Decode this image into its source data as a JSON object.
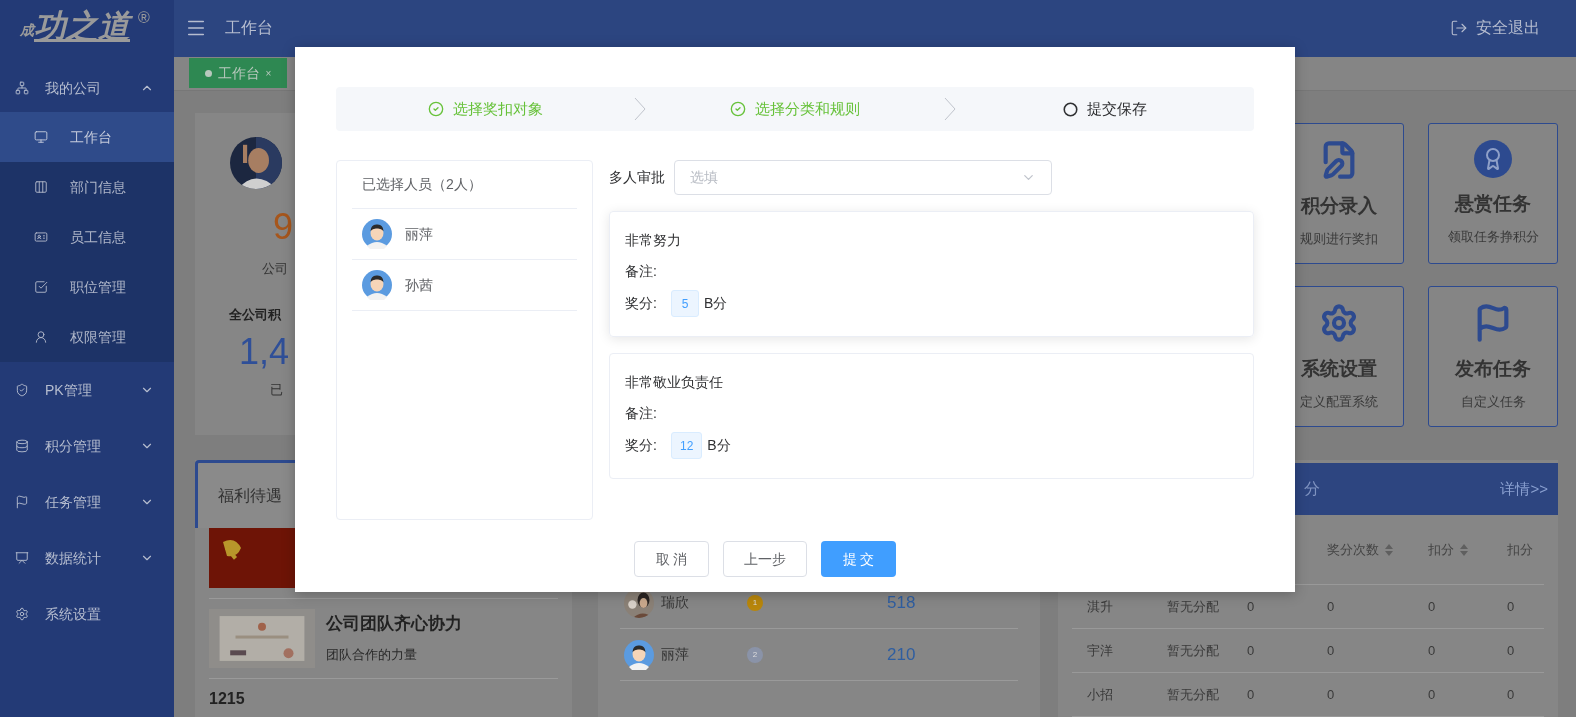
{
  "sidebar": {
    "logo": {
      "mark": "成",
      "name": "功之道",
      "reg": "®"
    },
    "menu": [
      {
        "label": "我的公司",
        "expanded": true,
        "children": [
          {
            "label": "工作台",
            "selected": true
          },
          {
            "label": "部门信息",
            "selected": false
          },
          {
            "label": "员工信息",
            "selected": false
          },
          {
            "label": "职位管理",
            "selected": false
          },
          {
            "label": "权限管理",
            "selected": false
          }
        ]
      },
      {
        "label": "PK管理",
        "expanded": false
      },
      {
        "label": "积分管理",
        "expanded": false
      },
      {
        "label": "任务管理",
        "expanded": false
      },
      {
        "label": "数据统计",
        "expanded": false
      },
      {
        "label": "系统设置"
      }
    ]
  },
  "header": {
    "title": "工作台",
    "logout": "安全退出"
  },
  "tabs": [
    {
      "label": "工作台",
      "selected": true,
      "close": "×"
    }
  ],
  "profile_card": {
    "score": "9",
    "company": "公司",
    "total_label": "全公司积",
    "total": "1,4",
    "awarded": "已"
  },
  "welfare": {
    "tab": "福利待遇",
    "items": [
      {
        "title": "公司团队齐心协力",
        "subtitle": "团队合作的力量"
      }
    ],
    "count": "1215"
  },
  "ranking": {
    "rows": [
      {
        "name": "瑞欣",
        "medal": "1",
        "color": "#b8860b",
        "score": "518"
      },
      {
        "name": "丽萍",
        "medal": "2",
        "color": "#8a93a8",
        "score": "210"
      }
    ]
  },
  "tiles": [
    {
      "title": "积分录入",
      "subtitle": "规则进行奖扣"
    },
    {
      "title": "悬赏任务",
      "subtitle": "领取任务挣积分"
    },
    {
      "title": "系统设置",
      "subtitle": "定义配置系统"
    },
    {
      "title": "发布任务",
      "subtitle": "自定义任务"
    }
  ],
  "table": {
    "title_fragment": "分",
    "details": "详情>>",
    "columns": [
      "",
      "",
      "",
      "奖分次数",
      "扣分",
      "扣分"
    ],
    "rows": [
      [
        "淇升",
        "暂无分配",
        "0",
        "0",
        "0",
        "0"
      ],
      [
        "宇洋",
        "暂无分配",
        "0",
        "0",
        "0",
        "0"
      ],
      [
        "小招",
        "暂无分配",
        "0",
        "0",
        "0",
        "0"
      ]
    ]
  },
  "dialog": {
    "steps": [
      {
        "label": "选择奖扣对象",
        "done": true
      },
      {
        "label": "选择分类和规则",
        "done": true
      },
      {
        "label": "提交保存",
        "done": false
      }
    ],
    "people_title": "已选择人员（2人）",
    "people": [
      "丽萍",
      "孙茜"
    ],
    "approval": {
      "label": "多人审批",
      "placeholder": "选填"
    },
    "rules": [
      {
        "title": "非常努力",
        "note_label": "备注:",
        "score_label": "奖分:",
        "score": "5",
        "unit": "B分"
      },
      {
        "title": "非常敬业负责任",
        "note_label": "备注:",
        "score_label": "奖分:",
        "score": "12",
        "unit": "B分"
      }
    ],
    "buttons": [
      {
        "label": "取 消",
        "kind": "plain"
      },
      {
        "label": "上一步",
        "kind": "plain"
      },
      {
        "label": "提 交",
        "kind": "primary"
      }
    ]
  }
}
